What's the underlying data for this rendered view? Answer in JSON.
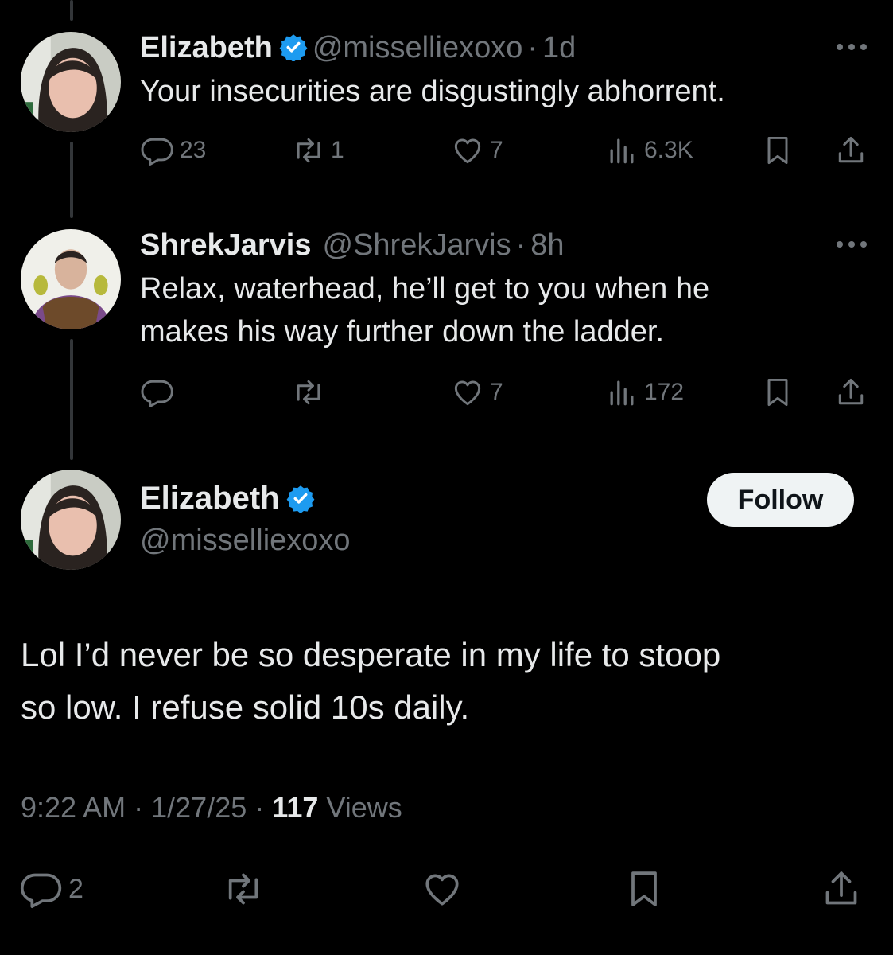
{
  "tweets": [
    {
      "name": "Elizabeth",
      "handle": "@misselliexoxo",
      "time": "1d",
      "text": "Your insecurities are disgustingly abhorrent.",
      "replies": "23",
      "retweets": "1",
      "likes": "7",
      "views": "6.3K"
    },
    {
      "name": "ShrekJarvis",
      "handle": "@ShrekJarvis",
      "time": "8h",
      "text_lines": [
        "Relax, waterhead, he’ll get to you when he",
        "makes his way further down the ladder."
      ],
      "replies": "",
      "retweets": "",
      "likes": "7",
      "views": "172"
    }
  ],
  "main": {
    "name": "Elizabeth",
    "handle": "@misselliexoxo",
    "follow_label": "Follow",
    "text_lines": [
      "Lol I’d never be so desperate in my life to stoop",
      "so low. I refuse solid 10s daily."
    ],
    "time": "9:22 AM",
    "date": "1/27/25",
    "views_count": "117",
    "views_label": "Views",
    "replies": "2"
  },
  "separator": "·",
  "colors": {
    "background": "#000000",
    "text": "#e7e9ea",
    "muted": "#71767b",
    "verified": "#1d9bf0",
    "button": "#eff3f4"
  },
  "icons": [
    "reply-icon",
    "retweet-icon",
    "like-icon",
    "views-icon",
    "bookmark-icon",
    "share-icon",
    "more-icon",
    "verified-badge-icon"
  ]
}
